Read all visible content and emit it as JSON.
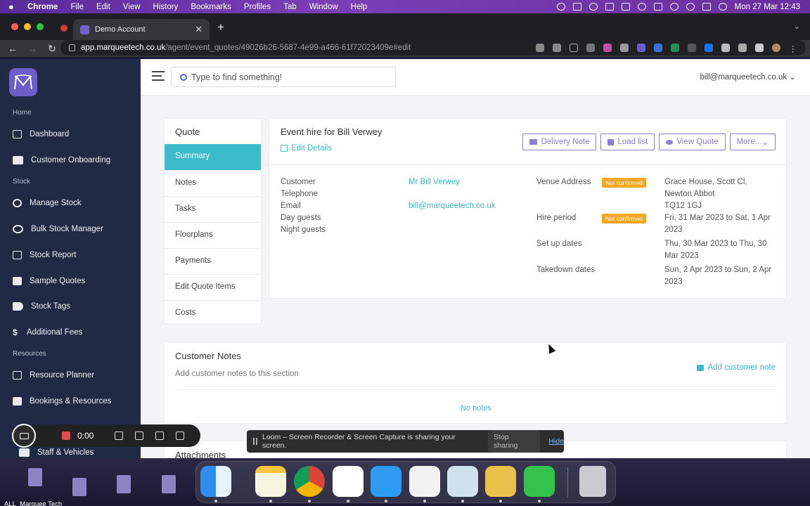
{
  "menubar": {
    "app": "Chrome",
    "items": [
      "File",
      "Edit",
      "View",
      "History",
      "Bookmarks",
      "Profiles",
      "Tab",
      "Window",
      "Help"
    ],
    "datetime": "Mon 27 Mar  12:43"
  },
  "browser": {
    "tab_title": "Demo Account",
    "url_host": "app.marqueetech.co.uk",
    "url_path": "/agent/event_quotes/49026b26-5687-4e99-a466-61f72023409e#edit"
  },
  "sidebar": {
    "sections": [
      {
        "label": "Home",
        "items": [
          {
            "label": "Dashboard",
            "icon": "dashboard-icon"
          },
          {
            "label": "Customer Onboarding",
            "icon": "users-icon"
          }
        ]
      },
      {
        "label": "Stock",
        "items": [
          {
            "label": "Manage Stock",
            "icon": "gear-icon"
          },
          {
            "label": "Bulk Stock Manager",
            "icon": "gears-icon"
          },
          {
            "label": "Stock Report",
            "icon": "chart-icon"
          },
          {
            "label": "Sample Quotes",
            "icon": "copy-icon"
          },
          {
            "label": "Stock Tags",
            "icon": "tag-icon"
          },
          {
            "label": "Additional Fees",
            "icon": "dollar-icon"
          }
        ]
      },
      {
        "label": "Resources",
        "items": [
          {
            "label": "Resource Planner",
            "icon": "calendar-icon"
          },
          {
            "label": "Bookings & Resources",
            "icon": "list-icon"
          },
          {
            "label": "Staff & Vehicles",
            "icon": "truck-icon"
          }
        ]
      }
    ]
  },
  "topbar": {
    "search_placeholder": "Type to find something!",
    "user": "bill@marqueetech.co.uk"
  },
  "quote_nav": {
    "title": "Quote",
    "items": [
      "Summary",
      "Notes",
      "Tasks",
      "Floorplans",
      "Payments",
      "Edit Quote Items",
      "Costs"
    ],
    "active": "Summary"
  },
  "event": {
    "title": "Event hire for Bill Verwey",
    "edit_label": "Edit Details",
    "buttons": [
      "Delivery Note",
      "Load list",
      "View Quote",
      "More..."
    ],
    "fields_left": {
      "labels": [
        "Customer",
        "Telephone",
        "Email",
        "Day guests",
        "Night guests"
      ],
      "customer": "Mr Bill Verwey",
      "email": "bill@marqueetech.co.uk"
    },
    "fields_right": {
      "venue_label": "Venue Address",
      "venue_lines": [
        "Grace House, Scott Cl,",
        "Newton Abbot",
        "TQ12 1GJ"
      ],
      "hire_label": "Hire period",
      "hire_lines": [
        "Fri, 31 Mar 2023 to Sat, 1 Apr",
        "2023"
      ],
      "setup_label": "Set up dates",
      "setup_lines": [
        "Thu, 30 Mar 2023 to Thu, 30",
        "Mar 2023"
      ],
      "takedown_label": "Takedown dates",
      "takedown_lines": [
        "Sun, 2 Apr 2023 to Sun, 2 Apr",
        "2023"
      ],
      "badge": "Not confirmed",
      "badge_color": "#f5a623"
    }
  },
  "customer_notes": {
    "title": "Customer Notes",
    "subtitle": "Add customer notes to this section",
    "add_label": "Add customer note",
    "empty": "No notes"
  },
  "attachments": {
    "title": "Attachments"
  },
  "loom": {
    "timer": "0:00",
    "share_message": "Loom – Screen Recorder & Screen Capture is sharing your screen.",
    "stop_label": "Stop sharing",
    "hide_label": "Hide"
  },
  "desktop": {
    "file_label": "ALL_Marquee Tech"
  },
  "colors": {
    "accent": "#3dbbc8",
    "button": "#8a7fd6",
    "sidebar": "#212a44"
  }
}
